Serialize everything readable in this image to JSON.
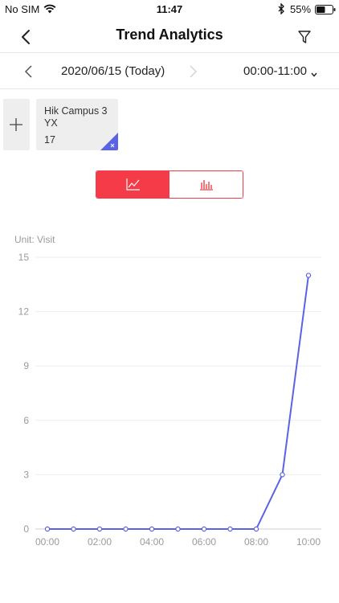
{
  "status_bar": {
    "carrier": "No SIM",
    "time": "11:47",
    "battery_percent": "55%",
    "battery_level": 0.55
  },
  "nav": {
    "title": "Trend Analytics"
  },
  "date_bar": {
    "date": "2020/06/15 (Today)",
    "time_range": "00:00-11:00"
  },
  "cards": [
    {
      "name": "Hik Campus 3 YX",
      "count": "17"
    }
  ],
  "view_toggle": {
    "selected": "line",
    "options": [
      "line",
      "bar"
    ]
  },
  "chart": {
    "unit_label": "Unit: Visit",
    "accent_color": "#5a63e6",
    "toggle_color": "#f53b47"
  },
  "chart_data": {
    "type": "line",
    "ylabel": "Unit: Visit",
    "ylim": [
      0,
      15
    ],
    "y_ticks": [
      0,
      3,
      6,
      9,
      12,
      15
    ],
    "x_tick_labels": [
      "00:00",
      "02:00",
      "04:00",
      "06:00",
      "08:00",
      "10:00"
    ],
    "grid": true,
    "series": [
      {
        "x": [
          "00:00",
          "01:00",
          "02:00",
          "03:00",
          "04:00",
          "05:00",
          "06:00",
          "07:00",
          "08:00",
          "09:00",
          "10:00"
        ],
        "values": [
          0,
          0,
          0,
          0,
          0,
          0,
          0,
          0,
          0,
          3,
          14
        ]
      }
    ]
  }
}
